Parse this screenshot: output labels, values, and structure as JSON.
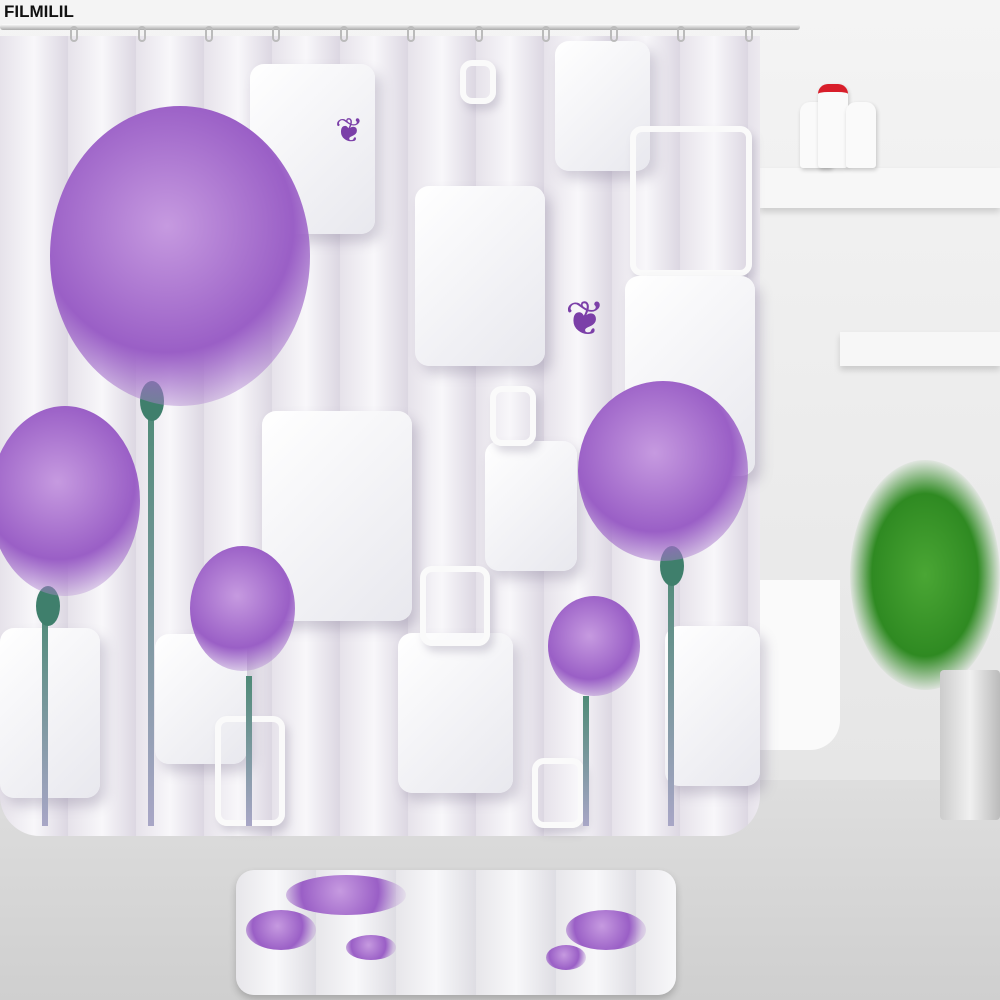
{
  "brand": {
    "label": "FILMILIL"
  }
}
